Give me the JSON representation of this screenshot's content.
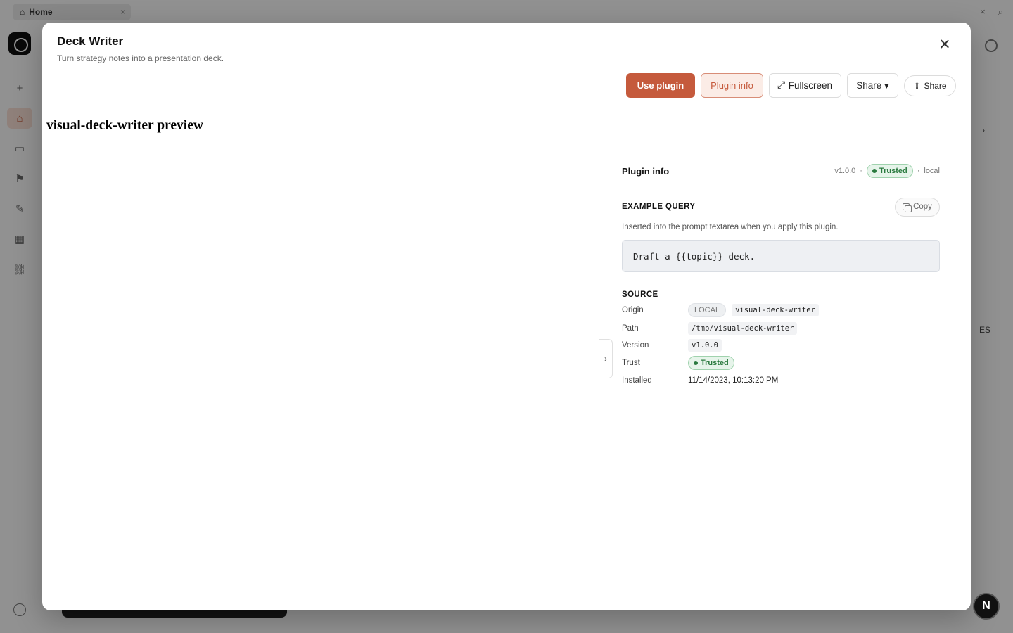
{
  "background": {
    "tab_label": "Home",
    "right_text_1": "›",
    "right_text_2": "ES"
  },
  "modal": {
    "title": "Deck Writer",
    "subtitle": "Turn strategy notes into a presentation deck.",
    "toolbar": {
      "use_plugin": "Use plugin",
      "plugin_info": "Plugin info",
      "fullscreen": "Fullscreen",
      "share_dropdown": "Share ▾",
      "share": "Share"
    }
  },
  "preview": {
    "title": "visual-deck-writer preview",
    "collapse_glyph": "›"
  },
  "info": {
    "title": "Plugin info",
    "version": "v1.0.0",
    "trust_badge": "Trusted",
    "source_short": "local",
    "separator": "·",
    "example_query": {
      "label": "EXAMPLE QUERY",
      "copy_label": "Copy",
      "description": "Inserted into the prompt textarea when you apply this plugin.",
      "code": "Draft a {{topic}} deck."
    },
    "source": {
      "label": "SOURCE",
      "origin_label": "Origin",
      "origin_chip": "LOCAL",
      "origin_name": "visual-deck-writer",
      "path_label": "Path",
      "path_value": "/tmp/visual-deck-writer",
      "version_label": "Version",
      "version_value": "v1.0.0",
      "trust_label": "Trust",
      "trust_value": "Trusted",
      "installed_label": "Installed",
      "installed_value": "11/14/2023, 10:13:20 PM"
    }
  },
  "floating_button": {
    "label": "N"
  },
  "colors": {
    "accent": "#c55a3c",
    "trusted_green": "#2a7a3f"
  }
}
